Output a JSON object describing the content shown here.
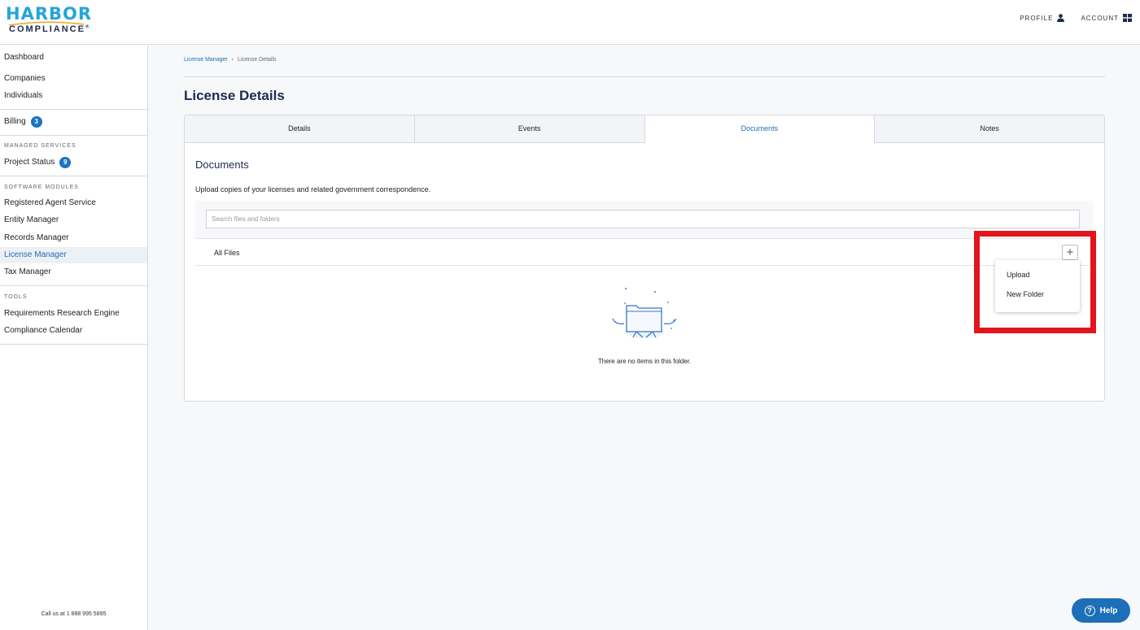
{
  "brand": {
    "name_top": "HARBOR",
    "name_bottom": "COMPLIANCE",
    "accent": "#25a4dc",
    "navy": "#1d2b4f"
  },
  "header": {
    "profile_label": "PROFILE",
    "account_label": "ACCOUNT",
    "profile_icon": "user-icon",
    "account_icon": "grid-icon"
  },
  "sidebar": {
    "items_top": [
      {
        "label": "Dashboard"
      },
      {
        "label": "Companies"
      },
      {
        "label": "Individuals"
      }
    ],
    "billing": {
      "label": "Billing",
      "badge": "3"
    },
    "managed_services": {
      "heading": "MANAGED SERVICES",
      "project_status": {
        "label": "Project Status",
        "badge": "9"
      }
    },
    "software_modules": {
      "heading": "SOFTWARE MODULES",
      "items": [
        {
          "label": "Registered Agent Service"
        },
        {
          "label": "Entity Manager"
        },
        {
          "label": "Records Manager"
        },
        {
          "label": "License Manager",
          "active": true
        },
        {
          "label": "Tax Manager"
        }
      ]
    },
    "tools": {
      "heading": "TOOLS",
      "items": [
        {
          "label": "Requirements Research Engine"
        },
        {
          "label": "Compliance Calendar"
        }
      ]
    },
    "call_us": "Call us at 1  888  995  5895"
  },
  "breadcrumb": {
    "parent": "License Manager",
    "separator": "›",
    "current": "License Details"
  },
  "page": {
    "title": "License Details"
  },
  "tabs": [
    {
      "label": "Details"
    },
    {
      "label": "Events"
    },
    {
      "label": "Documents",
      "active": true
    },
    {
      "label": "Notes"
    }
  ],
  "documents": {
    "title": "Documents",
    "description": "Upload copies of your licenses and related government correspondence.",
    "search_placeholder": "Search files and folders",
    "search_value": "",
    "folder_label": "All Files",
    "add_button_glyph": "+",
    "empty_text": "There are no items in this folder."
  },
  "dropdown": {
    "items": [
      "Upload",
      "New Folder"
    ]
  },
  "help": {
    "label": "Help",
    "glyph": "?"
  },
  "colors": {
    "link": "#1e6fb8",
    "badge": "#1c73c2",
    "highlight": "#e3141b",
    "help": "#1d6fb8"
  }
}
